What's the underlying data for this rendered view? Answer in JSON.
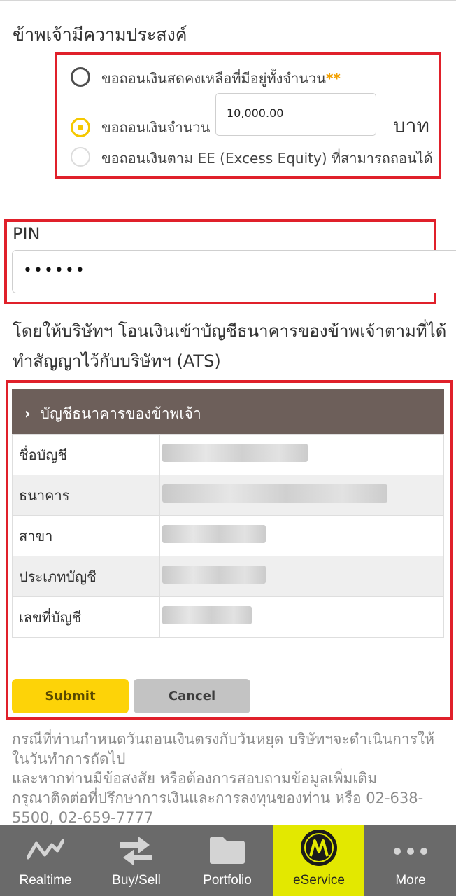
{
  "form": {
    "heading": "ข้าพเจ้ามีความประสงค์",
    "options": [
      {
        "label": "ขอถอนเงินสดคงเหลือที่มีอยู่ทั้งจำนวน",
        "suffix": "**",
        "selected": false
      },
      {
        "label": "ขอถอนเงินจำนวน",
        "selected": true
      },
      {
        "label": "ขอถอนเงินตาม EE (Excess Equity) ที่สามารถถอนได้",
        "selected": false
      }
    ],
    "amount_value": "10,000.00",
    "currency": "บาท",
    "pin_label": "PIN",
    "pin_value": "••••••",
    "intro": "โดยให้บริษัทฯ โอนเงินเข้าบัญชีธนาคารของข้าพเจ้าตามที่ได้ทำสัญญาไว้กับบริษัทฯ (ATS)"
  },
  "bank": {
    "header": "บัญชีธนาคารของข้าพเจ้า",
    "rows": [
      {
        "label": "ชื่อบัญชี"
      },
      {
        "label": "ธนาคาร"
      },
      {
        "label": "สาขา"
      },
      {
        "label": "ประเภทบัญชี"
      },
      {
        "label": "เลขที่บัญชี"
      }
    ]
  },
  "buttons": {
    "submit": "Submit",
    "cancel": "Cancel"
  },
  "note": {
    "line1": "กรณีที่ท่านกำหนดวันถอนเงินตรงกับวันหยุด บริษัทฯจะดำเนินการให้ในวันทำการถัดไป",
    "line2": "และหากท่านมีข้อสงสัย หรือต้องการสอบถามข้อมูลเพิ่มเติม",
    "line3": "กรุณาติดต่อที่ปรึกษาการเงินและการลงทุนของท่าน หรือ 02-638-5500, 02-659-7777"
  },
  "tabbar": {
    "items": [
      {
        "label": "Realtime",
        "icon": "chart-line-icon"
      },
      {
        "label": "Buy/Sell",
        "icon": "swap-arrows-icon"
      },
      {
        "label": "Portfolio",
        "icon": "folder-icon"
      },
      {
        "label": "eService",
        "icon": "bank-logo-icon",
        "active": true
      },
      {
        "label": "More",
        "icon": "more-dots-icon"
      }
    ]
  },
  "colors": {
    "highlight_border": "#e0202a",
    "accent_yellow": "#fdd308",
    "bank_header_bg": "#6d5f5a",
    "tabbar_bg": "#6a6a6a",
    "tab_active_bg": "#e3e800"
  }
}
